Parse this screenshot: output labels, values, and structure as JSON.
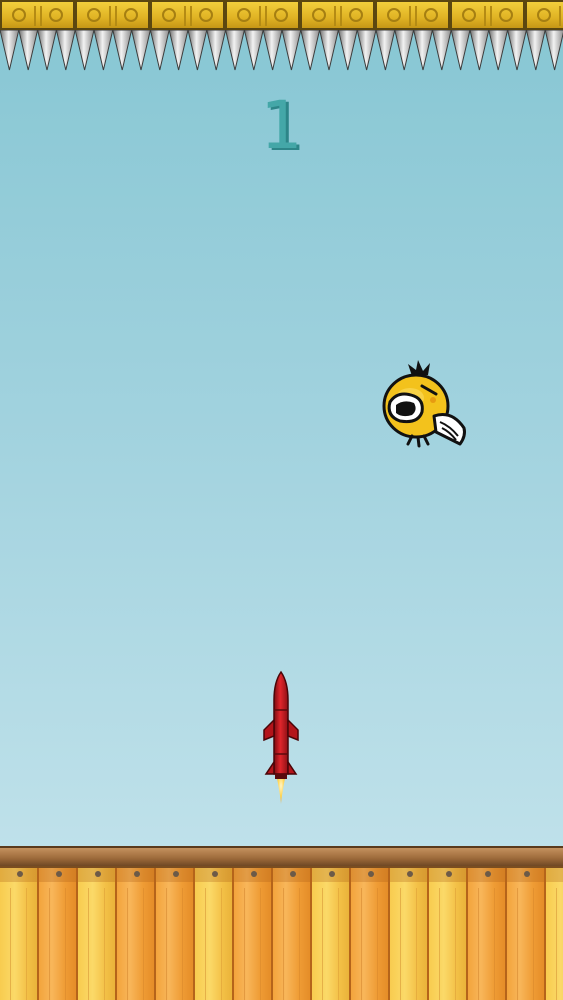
{
  "hud": {
    "score": "1"
  },
  "sprites": {
    "bird": "yellow-screaming-bird",
    "rocket": "red-rocket",
    "ceiling": "gold-blocks-with-spikes",
    "floor": "wooden-plank-floor"
  },
  "colors": {
    "sky_top": "#86c6d3",
    "sky_bottom": "#c6e5ee",
    "score": "#44a7a8",
    "bird_body": "#f3c21c",
    "rocket_body": "#c8141c",
    "plank_orange": "#f3a43c",
    "plank_yellow": "#f8cc4f",
    "block_gold": "#e0b324"
  }
}
